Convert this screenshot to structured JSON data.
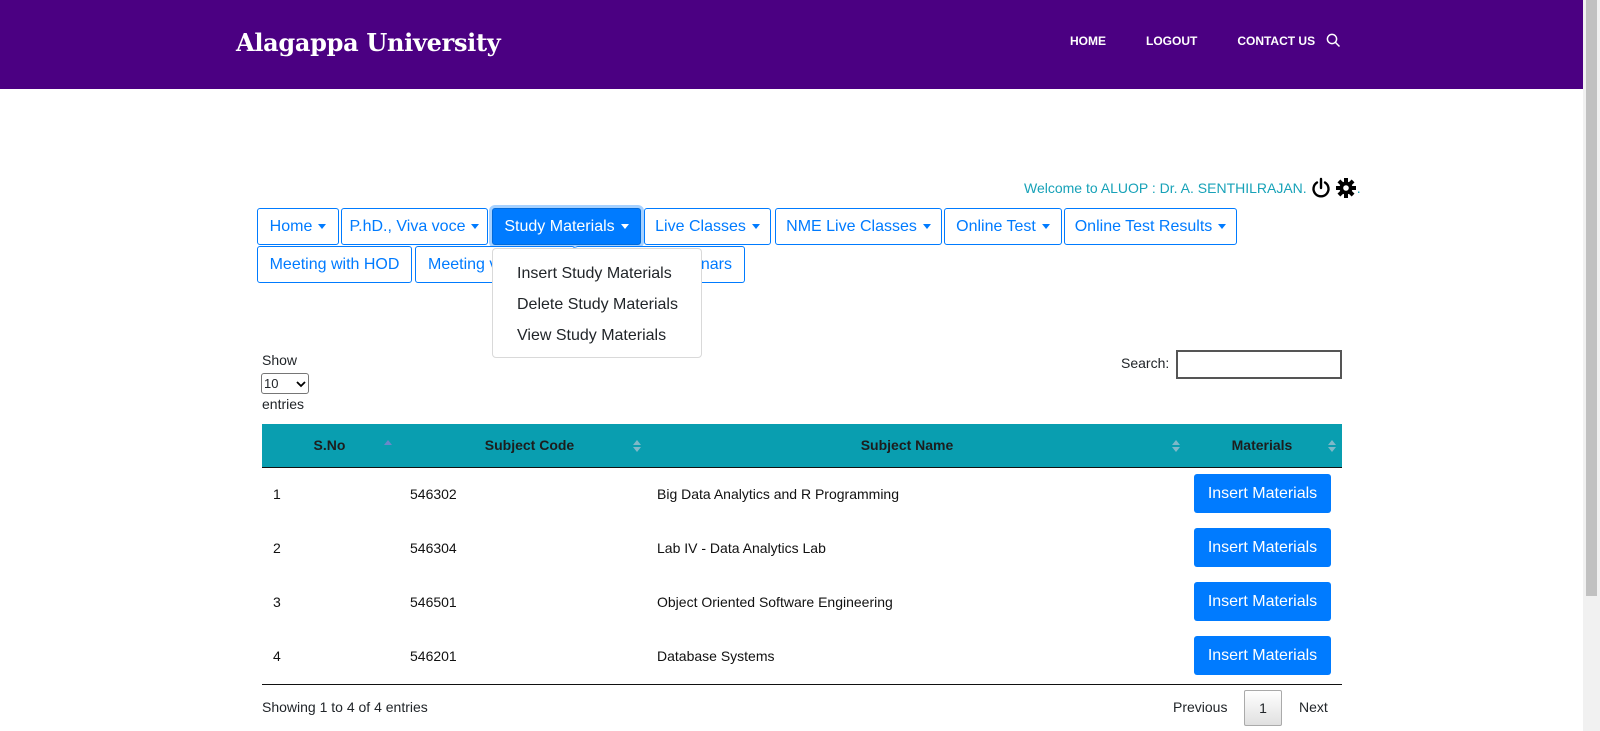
{
  "header": {
    "brand": "Alagappa University",
    "nav": [
      "HOME",
      "LOGOUT",
      "CONTACT US"
    ]
  },
  "welcome": {
    "text": "Welcome to ALUOP : Dr. A. SENTHILRAJAN.",
    "trailing": "."
  },
  "menu": {
    "row1": [
      "Home",
      "P.hD., Viva voce",
      "Study Materials",
      "Live Classes",
      "NME Live Classes",
      "Online Test",
      "Online Test Results"
    ],
    "row2": [
      "Meeting with HOD",
      "Meeting v",
      "nars"
    ]
  },
  "dropdown": {
    "items": [
      "Insert Study Materials",
      "Delete Study Materials",
      "View Study Materials"
    ]
  },
  "controls": {
    "show": "Show",
    "entries": "entries",
    "length_value": "10",
    "search_label": "Search:"
  },
  "table": {
    "headers": [
      "S.No",
      "Subject Code",
      "Subject Name",
      "Materials"
    ],
    "rows": [
      {
        "sno": "1",
        "code": "546302",
        "name": "Big Data Analytics and R Programming",
        "action": "Insert Materials"
      },
      {
        "sno": "2",
        "code": "546304",
        "name": "Lab IV - Data Analytics Lab",
        "action": "Insert Materials"
      },
      {
        "sno": "3",
        "code": "546501",
        "name": "Object Oriented Software Engineering",
        "action": "Insert Materials"
      },
      {
        "sno": "4",
        "code": "546201",
        "name": "Database Systems",
        "action": "Insert Materials"
      }
    ]
  },
  "footer": {
    "info": "Showing 1 to 4 of 4 entries",
    "previous": "Previous",
    "page": "1",
    "next": "Next"
  },
  "colors": {
    "header_bg": "#4b0082",
    "primary": "#007bff",
    "table_head": "#099eb0",
    "welcome": "#17a2b8"
  },
  "icons": [
    "search-icon",
    "power-icon",
    "gear-icon",
    "caret-down-icon",
    "sort-icon"
  ]
}
